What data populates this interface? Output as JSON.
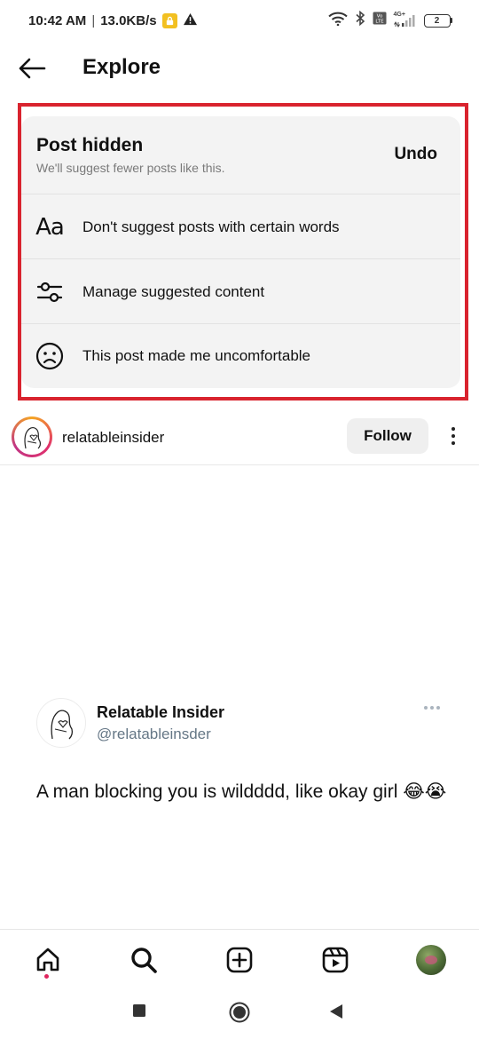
{
  "status_bar": {
    "time": "10:42 AM",
    "speed": "13.0KB/s",
    "network_label": "4G+",
    "battery_level": "2",
    "icons": [
      "lock-icon",
      "alert-icon",
      "wifi-icon",
      "bluetooth-icon",
      "volte-icon",
      "signal-icon",
      "battery-icon"
    ]
  },
  "header": {
    "title": "Explore",
    "back_icon": "arrow-left-icon"
  },
  "hidden_card": {
    "title": "Post hidden",
    "subtitle": "We'll suggest fewer posts like this.",
    "undo_label": "Undo",
    "options": [
      {
        "icon": "text-aa-icon",
        "label": "Don't suggest posts with certain words"
      },
      {
        "icon": "sliders-icon",
        "label": "Manage suggested content"
      },
      {
        "icon": "sad-face-icon",
        "label": "This post made me uncomfortable"
      }
    ],
    "highlight_color": "#d9232e"
  },
  "post": {
    "username": "relatableinsider",
    "follow_label": "Follow"
  },
  "tweet": {
    "name": "Relatable Insider",
    "handle": "@relatableinsder",
    "text": "A man blocking you is wildddd, like okay girl 😂😭"
  },
  "bottom_nav": {
    "items": [
      "home-icon",
      "search-icon",
      "create-icon",
      "reels-icon",
      "profile-avatar"
    ],
    "notification_color": "#e0245e"
  },
  "system_nav": {
    "items": [
      "recents-square-icon",
      "home-circle-icon",
      "back-triangle-icon"
    ]
  }
}
